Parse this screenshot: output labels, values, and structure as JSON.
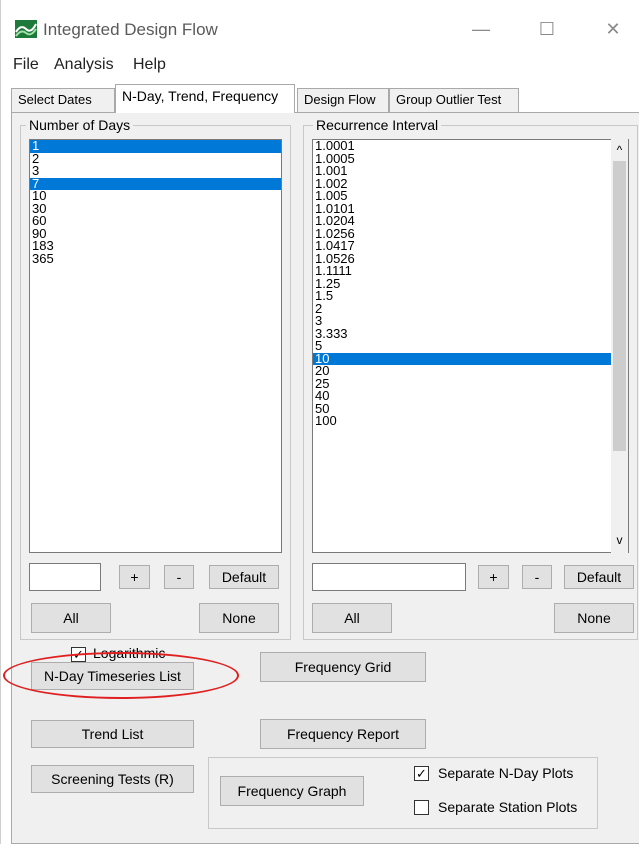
{
  "window": {
    "title": "Integrated Design Flow",
    "minimize_glyph": "—",
    "maximize_glyph": "☐",
    "close_glyph": "✕"
  },
  "menu": [
    "File",
    "Analysis",
    "Help"
  ],
  "tabs": [
    "Select Dates",
    "N-Day, Trend, Frequency",
    "Design Flow",
    "Group Outlier Test"
  ],
  "active_tab": 1,
  "ndays": {
    "title": "Number of Days",
    "items": [
      {
        "label": "1",
        "selected": true
      },
      {
        "label": "2",
        "selected": false
      },
      {
        "label": "3",
        "selected": false
      },
      {
        "label": "7",
        "selected": true
      },
      {
        "label": "10",
        "selected": false
      },
      {
        "label": "30",
        "selected": false
      },
      {
        "label": "60",
        "selected": false
      },
      {
        "label": "90",
        "selected": false
      },
      {
        "label": "183",
        "selected": false
      },
      {
        "label": "365",
        "selected": false
      }
    ],
    "input_value": "",
    "add_label": "+",
    "remove_label": "-",
    "default_label": "Default",
    "all_label": "All",
    "none_label": "None"
  },
  "recurrence": {
    "title": "Recurrence Interval",
    "items": [
      {
        "label": "1.0001",
        "selected": false
      },
      {
        "label": "1.0005",
        "selected": false
      },
      {
        "label": "1.001",
        "selected": false
      },
      {
        "label": "1.002",
        "selected": false
      },
      {
        "label": "1.005",
        "selected": false
      },
      {
        "label": "1.0101",
        "selected": false
      },
      {
        "label": "1.0204",
        "selected": false
      },
      {
        "label": "1.0256",
        "selected": false
      },
      {
        "label": "1.0417",
        "selected": false
      },
      {
        "label": "1.0526",
        "selected": false
      },
      {
        "label": "1.1111",
        "selected": false
      },
      {
        "label": "1.25",
        "selected": false
      },
      {
        "label": "1.5",
        "selected": false
      },
      {
        "label": "2",
        "selected": false
      },
      {
        "label": "3",
        "selected": false
      },
      {
        "label": "3.333",
        "selected": false
      },
      {
        "label": "5",
        "selected": false
      },
      {
        "label": "10",
        "selected": true
      },
      {
        "label": "20",
        "selected": false
      },
      {
        "label": "25",
        "selected": false
      },
      {
        "label": "40",
        "selected": false
      },
      {
        "label": "50",
        "selected": false
      },
      {
        "label": "100",
        "selected": false
      }
    ],
    "input_value": "",
    "add_label": "+",
    "remove_label": "-",
    "default_label": "Default",
    "all_label": "All",
    "none_label": "None",
    "scroll_up_glyph": "^",
    "scroll_down_glyph": "v"
  },
  "logarithmic": {
    "label": "Logarithmic",
    "checked": true
  },
  "actions": {
    "nday_timeseries": "N-Day Timeseries List",
    "trend_list": "Trend List",
    "screening_tests": "Screening Tests (R)",
    "frequency_grid": "Frequency Grid",
    "frequency_report": "Frequency Report",
    "frequency_graph": "Frequency Graph"
  },
  "plot_options": {
    "separate_nday": {
      "label": "Separate N-Day Plots",
      "checked": true
    },
    "separate_station": {
      "label": "Separate Station Plots",
      "checked": false
    }
  },
  "colors": {
    "selection": "#0078d7",
    "highlight_circle": "#e02020"
  }
}
